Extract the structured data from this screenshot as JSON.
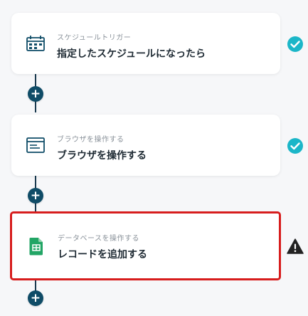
{
  "colors": {
    "accent": "#0f4c67",
    "check": "#1bb6c8",
    "warning": "#222222",
    "selected_border": "#d71d1d",
    "sheets_green": "#22a565"
  },
  "flow": {
    "steps": [
      {
        "subtitle": "スケジュールトリガー",
        "title": "指定したスケジュールになったら",
        "icon": "calendar-icon",
        "status": "check-circle-icon"
      },
      {
        "subtitle": "ブラウザを操作する",
        "title": "ブラウザを操作する",
        "icon": "browser-window-icon",
        "status": "check-circle-icon"
      },
      {
        "subtitle": "データベースを操作する",
        "title": "レコードを追加する",
        "icon": "google-sheets-icon",
        "status": "warning-icon"
      }
    ],
    "add_step_label": "+"
  }
}
